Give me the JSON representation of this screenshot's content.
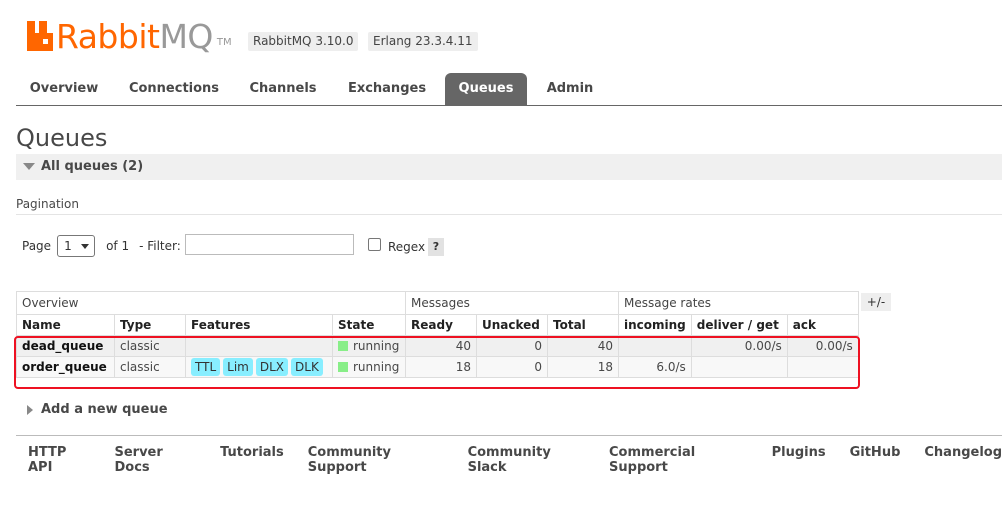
{
  "header": {
    "logo_rabbit": "Rabbit",
    "logo_mq": "MQ",
    "logo_tm": "TM",
    "version": "RabbitMQ 3.10.0",
    "erlang": "Erlang 23.3.4.11",
    "brand_color": "#ff6600"
  },
  "tabs": [
    "Overview",
    "Connections",
    "Channels",
    "Exchanges",
    "Queues",
    "Admin"
  ],
  "active_tab": "Queues",
  "page": {
    "title": "Queues",
    "section": "All queues (2)",
    "pagination_label": "Pagination",
    "page_label": "Page",
    "page_value": "1",
    "of_label": "of 1",
    "filter_label": "- Filter:",
    "filter_value": "",
    "regex_label": "Regex",
    "regex_help": "?"
  },
  "table": {
    "groups": {
      "overview": "Overview",
      "messages": "Messages",
      "rates": "Message rates"
    },
    "plusminus": "+/-",
    "columns": [
      "Name",
      "Type",
      "Features",
      "State",
      "Ready",
      "Unacked",
      "Total",
      "incoming",
      "deliver / get",
      "ack"
    ],
    "rows": [
      {
        "name": "dead_queue",
        "type": "classic",
        "features": [],
        "state": "running",
        "ready": "40",
        "unacked": "0",
        "total": "40",
        "incoming": "",
        "deliver": "0.00/s",
        "ack": "0.00/s"
      },
      {
        "name": "order_queue",
        "type": "classic",
        "features": [
          "TTL",
          "Lim",
          "DLX",
          "DLK"
        ],
        "state": "running",
        "ready": "18",
        "unacked": "0",
        "total": "18",
        "incoming": "6.0/s",
        "deliver": "",
        "ack": ""
      }
    ]
  },
  "add_queue": "Add a new queue",
  "footer": [
    "HTTP API",
    "Server Docs",
    "Tutorials",
    "Community Support",
    "Community Slack",
    "Commercial Support",
    "Plugins",
    "GitHub",
    "Changelog"
  ]
}
